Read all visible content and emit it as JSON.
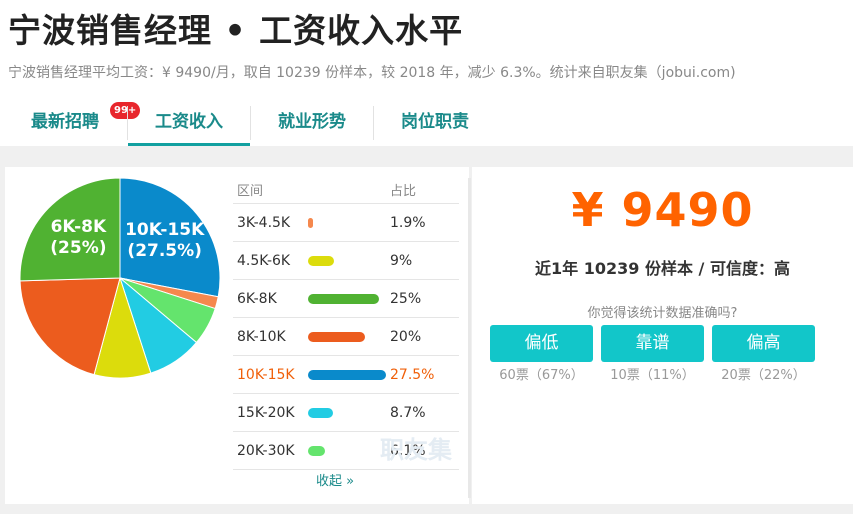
{
  "header": {
    "title": "宁波销售经理 • 工资收入水平",
    "subtitle": "宁波销售经理平均工资：¥ 9490/月，取自 10239 份样本，较 2018 年，减少 6.3%。统计来自职友集（jobui.com)"
  },
  "tabs": [
    {
      "label": "最新招聘",
      "badge": "99+"
    },
    {
      "label": "工资收入"
    },
    {
      "label": "就业形势"
    },
    {
      "label": "岗位职责"
    }
  ],
  "table": {
    "col_range": "区间",
    "col_ratio": "占比",
    "collapse_label": "收起 »"
  },
  "chart_data": {
    "type": "pie",
    "categories": [
      "3K-4.5K",
      "4.5K-6K",
      "6K-8K",
      "8K-10K",
      "10K-15K",
      "15K-20K",
      "20K-30K"
    ],
    "values": [
      1.9,
      9,
      25,
      20,
      27.5,
      8.7,
      6.1
    ],
    "value_labels": [
      "1.9%",
      "9%",
      "25%",
      "20%",
      "27.5%",
      "8.7%",
      "6.1%"
    ],
    "colors": [
      "#f5884d",
      "#dcdc0c",
      "#50b232",
      "#ec5c1e",
      "#0a8acb",
      "#22cce3",
      "#64e46d"
    ],
    "highlight_index": 4,
    "slice_labels": [
      {
        "index": 4,
        "line1": "10K-15K",
        "line2": "(27.5%)"
      },
      {
        "index": 2,
        "line1": "6K-8K",
        "line2": "(25%)"
      }
    ]
  },
  "summary": {
    "salary": "¥ 9490",
    "sample_text": "近1年 10239 份样本 / 可信度：高",
    "question": "你觉得该统计数据准确吗?"
  },
  "votes": [
    {
      "label": "偏低",
      "count": "60票（67%）"
    },
    {
      "label": "靠谱",
      "count": "10票（11%）"
    },
    {
      "label": "偏高",
      "count": "20票（22%）"
    }
  ],
  "watermark": "职友集",
  "colors": {
    "accent": "#12c6c9",
    "salary": "#ff6300",
    "highlight": "#f0600a",
    "tab": "#1a8a8a"
  }
}
